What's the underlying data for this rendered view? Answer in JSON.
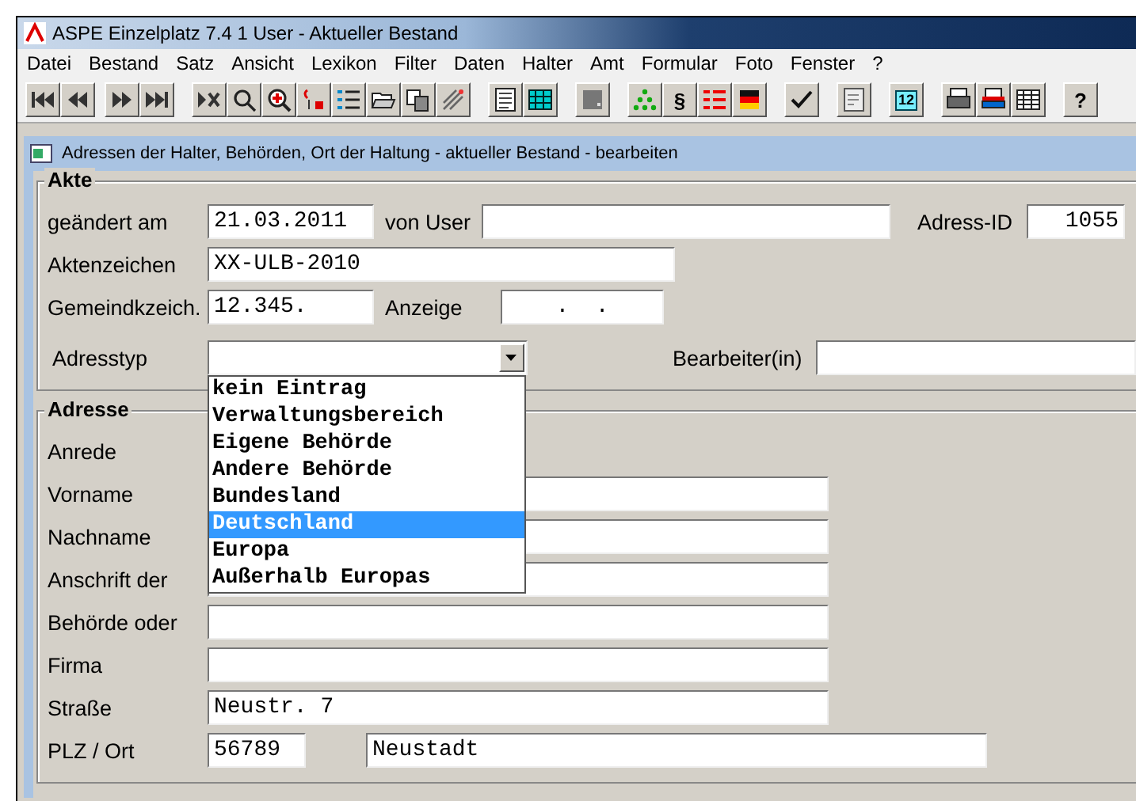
{
  "window": {
    "title": "ASPE Einzelplatz 7.4  1 User - Aktueller Bestand"
  },
  "menu": [
    {
      "label": "Datei"
    },
    {
      "label": "Bestand"
    },
    {
      "label": "Satz"
    },
    {
      "label": "Ansicht"
    },
    {
      "label": "Lexikon"
    },
    {
      "label": "Filter"
    },
    {
      "label": "Daten"
    },
    {
      "label": "Halter"
    },
    {
      "label": "Amt"
    },
    {
      "label": "Formular"
    },
    {
      "label": "Foto"
    },
    {
      "label": "Fenster"
    },
    {
      "label": "?"
    }
  ],
  "toolbar": {
    "paragraph_label": "§",
    "calendar_label": "12",
    "help_label": "?"
  },
  "form": {
    "title": "Adressen der Halter, Behörden, Ort der Haltung - aktueller Bestand - bearbeiten",
    "akte": {
      "legend": "Akte",
      "geaendert": {
        "label": "geändert am",
        "value": "21.03.2011"
      },
      "von_user": {
        "label": "von User"
      },
      "adress_id": {
        "label": "Adress-ID",
        "value": "1055"
      },
      "aktenzeichen": {
        "label": "Aktenzeichen",
        "value": "XX-ULB-2010"
      },
      "gemeindkzeich": {
        "label": "Gemeindkzeich.",
        "value": "12.345."
      },
      "anzeige": {
        "label": "Anzeige",
        "value": ".  ."
      },
      "adresstyp": {
        "label": "Adresstyp",
        "expanded": true,
        "options": [
          {
            "label": "kein Eintrag",
            "selected": false
          },
          {
            "label": "Verwaltungsbereich",
            "selected": false
          },
          {
            "label": "Eigene Behörde",
            "selected": false
          },
          {
            "label": "Andere Behörde",
            "selected": false
          },
          {
            "label": "Bundesland",
            "selected": false
          },
          {
            "label": "Deutschland",
            "selected": true
          },
          {
            "label": "Europa",
            "selected": false
          },
          {
            "label": "Außerhalb Europas",
            "selected": false
          }
        ]
      },
      "bearbeiter": {
        "label": "Bearbeiter(in)"
      }
    },
    "adresse": {
      "legend": "Adresse",
      "anrede": {
        "label": "Anrede"
      },
      "fields": [
        {
          "label": "Vorname"
        },
        {
          "label": "Nachname"
        },
        {
          "label": "Anschrift der"
        },
        {
          "label": "Behörde oder"
        },
        {
          "label": "Firma"
        },
        {
          "label": "Straße",
          "value": "Neustr. 7"
        }
      ],
      "plz_ort": {
        "label": "PLZ / Ort",
        "plz": "56789",
        "ort": "Neustadt"
      }
    }
  }
}
